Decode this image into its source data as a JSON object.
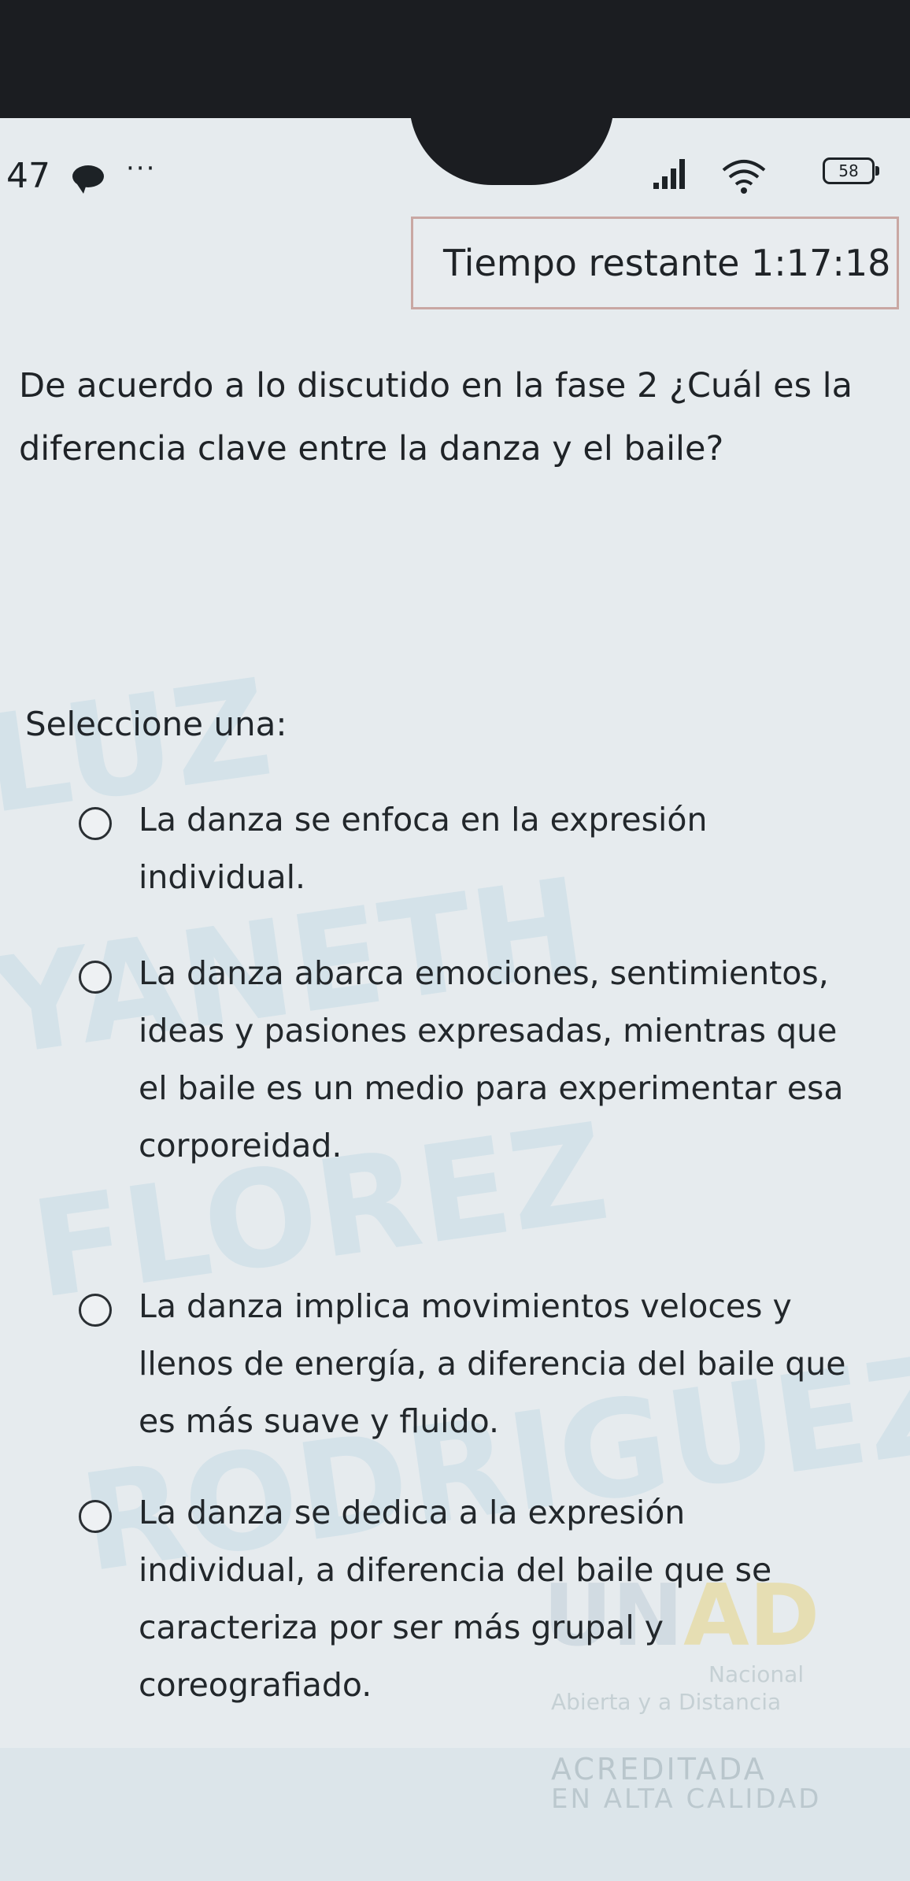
{
  "status_bar": {
    "time": "47",
    "more": "···",
    "battery": "58"
  },
  "timer": {
    "text": "Tiempo restante 1:17:18"
  },
  "question": {
    "text": "De acuerdo a lo discutido en la fase 2 ¿Cuál es la diferencia clave entre la danza y el baile?"
  },
  "prompt": "Seleccione una:",
  "options": [
    {
      "text": "La danza se enfoca en la expresión individual."
    },
    {
      "text": "La danza abarca emociones, sentimientos, ideas y pasiones expresadas, mientras que el baile es un medio para experimentar esa corporeidad."
    },
    {
      "text": "La danza implica movimientos veloces y llenos de energía, a diferencia del baile que es más suave y fluido."
    },
    {
      "text": "La danza se dedica a la expresión individual, a diferencia del baile que se caracteriza por ser más grupal y coreografiado."
    }
  ],
  "watermark": {
    "line1": "LUZ",
    "line2": "YANETH",
    "line3": "FLOREZ",
    "line4": "RODRIGUEZ",
    "logo_un": "UN",
    "logo_ad": "AD",
    "logo_sub1": "Nacional",
    "logo_sub2": "Abierta y a Distancia",
    "acc1": "ACREDITADA",
    "acc2": "EN ALTA CALIDAD"
  }
}
